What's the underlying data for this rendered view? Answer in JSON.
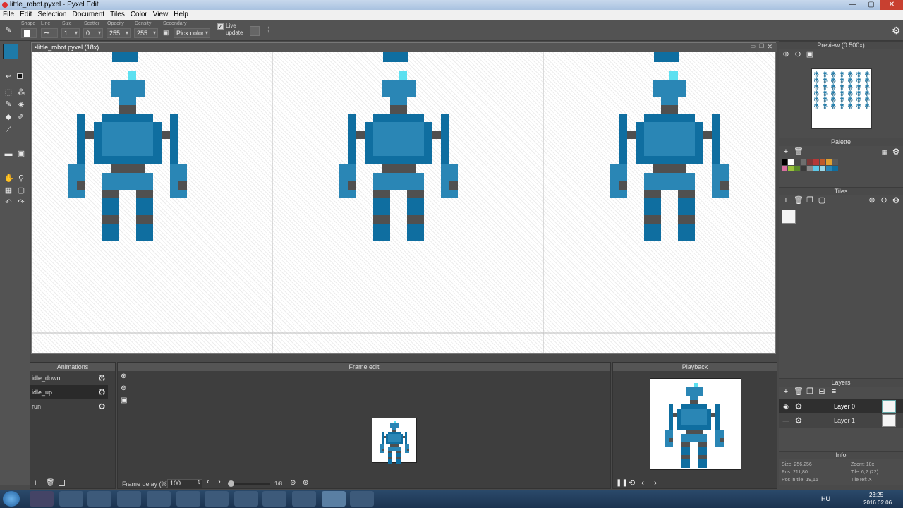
{
  "window": {
    "title": "little_robot.pyxel - Pyxel Edit",
    "minimize": "—",
    "maximize": "▢",
    "close": "✕"
  },
  "menu": [
    "File",
    "Edit",
    "Selection",
    "Document",
    "Tiles",
    "Color",
    "View",
    "Help"
  ],
  "toolbar": {
    "shape_label": "Shape",
    "line_label": "Line",
    "size_label": "Size",
    "size_value": "1",
    "scatter_label": "Scatter",
    "scatter_value": "0",
    "opacity_label": "Opacity",
    "opacity_value": "255",
    "density_label": "Density",
    "density_value": "255",
    "secondary_label": "Secondary",
    "secondary_value": "Pick color",
    "live_update_label": "Live update",
    "live_update_checked": true
  },
  "canvas": {
    "tab_title": "•little_robot.pyxel   (18x)"
  },
  "preview": {
    "title": "Preview (0.500x)"
  },
  "palette": {
    "title": "Palette",
    "colors": [
      "#000000",
      "#ffffff",
      "#4a4a4a",
      "#6e6e6e",
      "#7d3838",
      "#b53838",
      "#c05a2a",
      "#e0a030",
      "#5a5a5a",
      "#d86f9f",
      "#9ac23a",
      "#5a8a2a",
      "#3a3a3a",
      "#8a8a8a",
      "#5cc8e8",
      "#9ad8e8",
      "#2a86b5",
      "#0f6ea0"
    ]
  },
  "tiles": {
    "title": "Tiles"
  },
  "layers": {
    "title": "Layers",
    "items": [
      {
        "name": "Layer 0"
      },
      {
        "name": "Layer 1"
      }
    ]
  },
  "info": {
    "title": "Info",
    "size": "Size: 256,256",
    "zoom": "Zoom: 18x",
    "pos": "Pos: 211,80",
    "tile": "Tile: 6,2 (22)",
    "pos_in_tile": "Pos in tile: 19,16",
    "tile_ref": "Tile ref: X"
  },
  "animations": {
    "title": "Animations",
    "items": [
      "idle_down",
      "idle_up",
      "run"
    ]
  },
  "frame_edit": {
    "title": "Frame edit",
    "delay_label": "Frame delay (%)",
    "delay_value": "100",
    "frame_counter": "1/8"
  },
  "playback": {
    "title": "Playback"
  },
  "taskbar": {
    "lang": "HU",
    "time": "23:25",
    "date": "2016.02.06."
  },
  "colors": {
    "accent": "#1e7aa8",
    "robot_dark": "#0f6ea0",
    "robot_mid": "#2a86b5",
    "robot_light": "#4a9eb8",
    "robot_cyan": "#5ce0f0",
    "robot_grey": "#505050"
  }
}
